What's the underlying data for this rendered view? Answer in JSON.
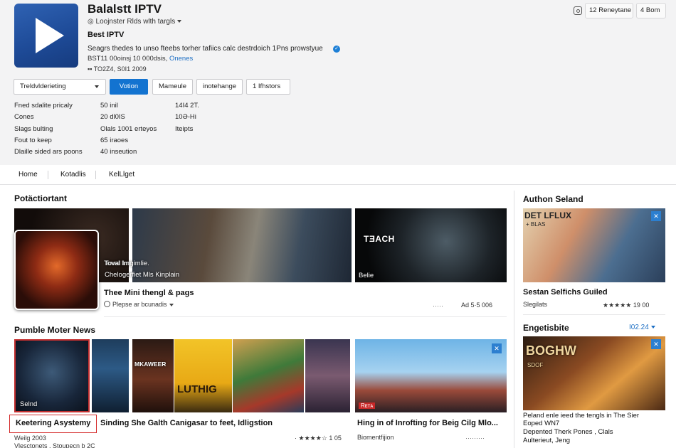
{
  "app": {
    "title": "Balalstt IPTV",
    "publisher": "◎ Loojnster Rlds wlth targls",
    "subtitle": "Best IPTV",
    "description": "Seagrs thedes to unso fteebs torher tafiics calc destrdoich 1Pns prowstyue",
    "stats_text": "BST11 00oinsj 10 000dsis, ",
    "stats_link": "Onenes",
    "meta": "▪▪ TO2Z4,  S0I1 2009"
  },
  "top_actions": {
    "count": "12",
    "reneytane": "Reneytane",
    "bom": "4 Bom"
  },
  "controls": {
    "dropdown": "Treldvlderieting",
    "primary": "Votion",
    "btn2": "Mameule",
    "btn3": "inotehange",
    "btn4": "1 Ifhstors"
  },
  "info": {
    "col1": [
      "Fned sdalite pricaly",
      "Cones",
      "Slags bulting",
      "Fout to keep",
      "Dlaille sided ars poons"
    ],
    "col2": [
      "50 inil",
      "20 dl0IS",
      "Olals 1001 erteyos",
      "65 iraoes",
      "40 inseution"
    ],
    "col3": [
      "14I4 2T.",
      "10Ə-Hi",
      "Iteipts"
    ]
  },
  "nav": [
    "Home",
    "Kotadlis",
    "KelLlget"
  ],
  "section1": {
    "title": "Potäctiortant",
    "tile1_caption": "Toval Imgimlie.",
    "tile1_caption2": "Chelogerfiet Mls Kinplain",
    "tile3_logo": "TƎACH",
    "tile3_caption": "Belie",
    "card_title": "Thee Mini thengl & pags",
    "card_sub": "Plepse ar bcunadis",
    "card_meta": "Ad 5·5 006",
    "card_meta_faint": "·····"
  },
  "section2": {
    "title": "Pumble Moter News",
    "tile1_caption": "Selnd",
    "poster_a": "MKAWEER",
    "poster_b": "LUTHIG",
    "tile5_caption": "Rᴇᴛᴀ",
    "item1_title": "Keetering Asystemy",
    "item1_sub": "Weilg 2003",
    "item1_sub2": "Vlesctonets . Stoupecn b 2C",
    "item2_title": "Sinding She Galth Canigasar to feet, Idligstion",
    "item2_meta": "· ★★★★☆ 1 05",
    "item3_title": "Hing in of Inrofting for Beig Cilg Mlo...",
    "item3_sub": "Biomentfijion",
    "item3_meta": "·········"
  },
  "sidebar": {
    "title1": "Authon Seland",
    "img1_text": "DET LFLUX",
    "img1_text2": "+ BLAS",
    "card1_title": "Sestan Selfichs Guiled",
    "card1_sub": "Slegilats",
    "card1_meta": "★★★★★ 19 00",
    "title2": "Engetisbite",
    "title2_value": "I02.24",
    "img2_text": "BOGHW",
    "img2_text2": "SDOF",
    "card2_title": "Peland enle ieed the tengls in The Sier",
    "card2_title2": "Eoped WN7",
    "card2_sub": "Depented Therk Pones , Clals",
    "card2_sub2": "Aulterieut, Jeng"
  },
  "colors": {
    "accent": "#1373d0",
    "header_bg": "#f3f3f4",
    "highlight": "#d42a2a"
  }
}
